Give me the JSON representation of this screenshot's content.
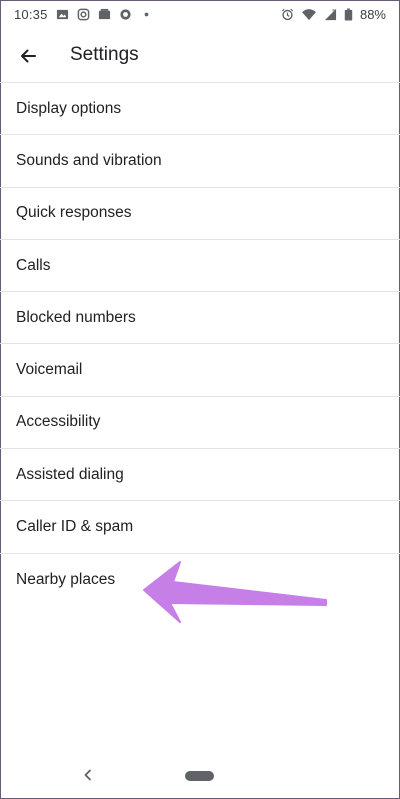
{
  "status_bar": {
    "time": "10:35",
    "battery": "88%",
    "left_icons": [
      "image-icon",
      "instagram-icon",
      "media-icon",
      "circle-app-icon",
      "dot-icon"
    ],
    "right_icons": [
      "alarm-icon",
      "wifi-icon",
      "signal-icon",
      "battery-icon"
    ]
  },
  "app_bar": {
    "title": "Settings",
    "back_icon": "arrow-back-icon"
  },
  "settings": {
    "items": [
      {
        "label": "Display options"
      },
      {
        "label": "Sounds and vibration"
      },
      {
        "label": "Quick responses"
      },
      {
        "label": "Calls"
      },
      {
        "label": "Blocked numbers"
      },
      {
        "label": "Voicemail"
      },
      {
        "label": "Accessibility"
      },
      {
        "label": "Assisted dialing"
      },
      {
        "label": "Caller ID & spam"
      },
      {
        "label": "Nearby places"
      }
    ]
  },
  "annotation": {
    "color": "#c77fe8",
    "icon": "arrow-left-annotation"
  },
  "nav_bar": {
    "back_icon": "chevron-left-icon",
    "home_icon": "home-pill-icon"
  }
}
